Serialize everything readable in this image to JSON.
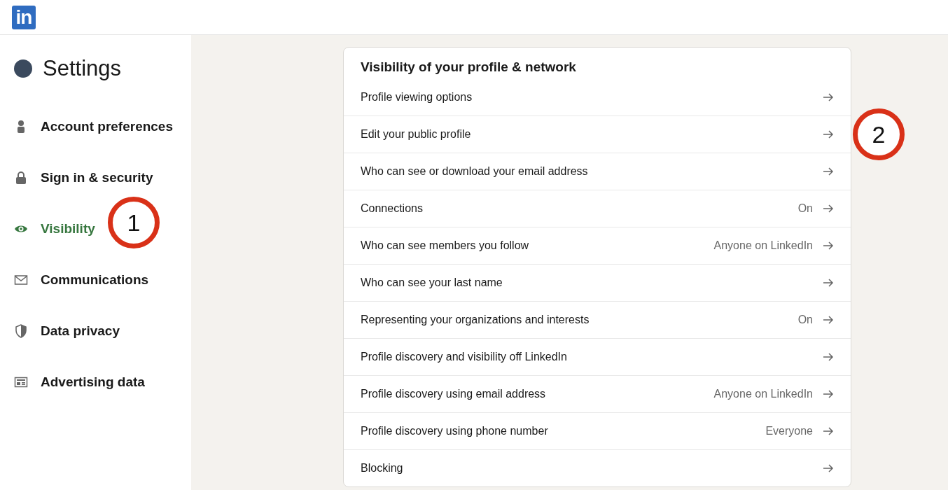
{
  "header": {
    "logo": "in"
  },
  "sidebar": {
    "title": "Settings",
    "items": [
      {
        "kind": "account",
        "label": "Account preferences",
        "selected": false
      },
      {
        "kind": "security",
        "label": "Sign in & security",
        "selected": false
      },
      {
        "kind": "visibility",
        "label": "Visibility",
        "selected": true
      },
      {
        "kind": "communications",
        "label": "Communications",
        "selected": false
      },
      {
        "kind": "privacy",
        "label": "Data privacy",
        "selected": false
      },
      {
        "kind": "advertising",
        "label": "Advertising data",
        "selected": false
      }
    ]
  },
  "section": {
    "title": "Visibility of your profile & network",
    "rows": [
      {
        "label": "Profile viewing options"
      },
      {
        "label": "Edit your public profile"
      },
      {
        "label": "Who can see or download your email address"
      },
      {
        "label": "Connections",
        "value": "On"
      },
      {
        "label": "Who can see members you follow",
        "value": "Anyone on LinkedIn"
      },
      {
        "label": "Who can see your last name"
      },
      {
        "label": "Representing your organizations and interests",
        "value": "On"
      },
      {
        "label": "Profile discovery and visibility off LinkedIn"
      },
      {
        "label": "Profile discovery using email address",
        "value": "Anyone on LinkedIn"
      },
      {
        "label": "Profile discovery using phone number",
        "value": "Everyone"
      },
      {
        "label": "Blocking"
      }
    ]
  },
  "callouts": [
    {
      "label": "1"
    },
    {
      "label": "2"
    }
  ]
}
